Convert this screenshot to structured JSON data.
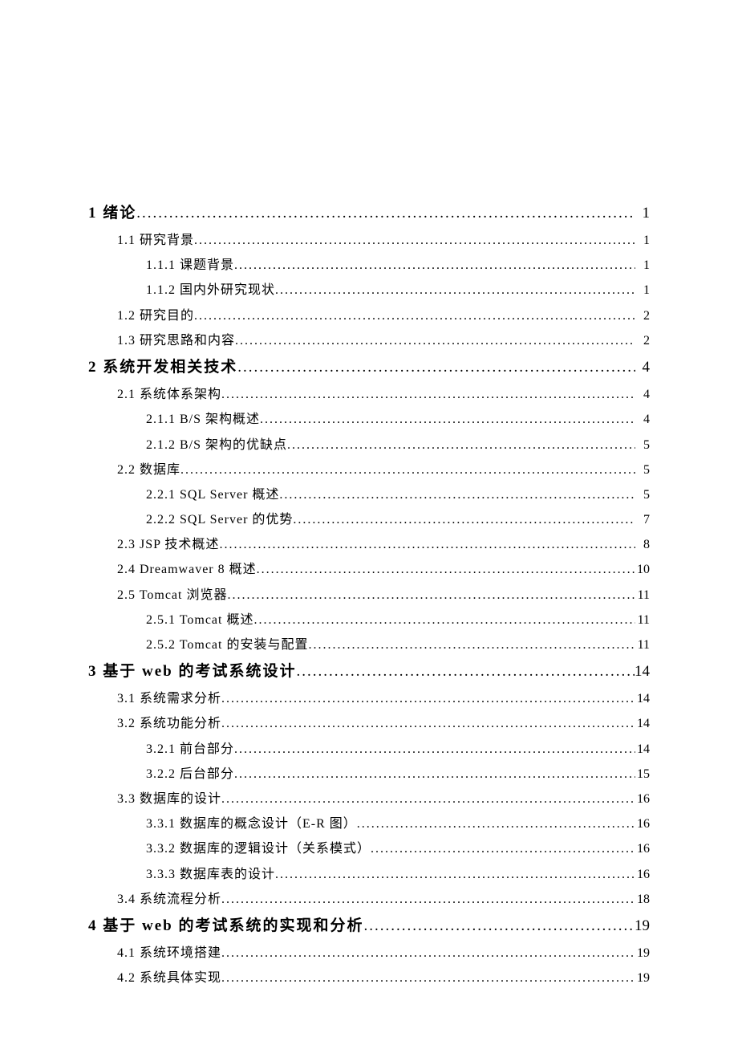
{
  "toc": [
    {
      "level": 0,
      "label": "1 绪论",
      "page": "1"
    },
    {
      "level": 1,
      "label": "1.1 研究背景",
      "page": "1"
    },
    {
      "level": 2,
      "label": "1.1.1 课题背景",
      "page": "1"
    },
    {
      "level": 2,
      "label": "1.1.2 国内外研究现状",
      "page": "1"
    },
    {
      "level": 1,
      "label": "1.2 研究目的",
      "page": "2"
    },
    {
      "level": 1,
      "label": "1.3 研究思路和内容",
      "page": "2"
    },
    {
      "level": 0,
      "label": "2 系统开发相关技术",
      "page": "4"
    },
    {
      "level": 1,
      "label": "2.1 系统体系架构",
      "page": "4"
    },
    {
      "level": 2,
      "label": "2.1.1 B/S 架构概述",
      "page": "4"
    },
    {
      "level": 2,
      "label": "2.1.2 B/S 架构的优缺点",
      "page": "5"
    },
    {
      "level": 1,
      "label": "2.2 数据库",
      "page": "5"
    },
    {
      "level": 2,
      "label": "2.2.1 SQL Server 概述",
      "page": "5"
    },
    {
      "level": 2,
      "label": "2.2.2 SQL Server 的优势",
      "page": "7"
    },
    {
      "level": 1,
      "label": "2.3 JSP 技术概述",
      "page": "8"
    },
    {
      "level": 1,
      "label": "2.4 Dreamwaver 8 概述",
      "page": "10"
    },
    {
      "level": 1,
      "label": "2.5 Tomcat 浏览器",
      "page": "11"
    },
    {
      "level": 2,
      "label": "2.5.1 Tomcat 概述",
      "page": "11"
    },
    {
      "level": 2,
      "label": "2.5.2 Tomcat 的安装与配置",
      "page": "11"
    },
    {
      "level": 0,
      "label": "3 基于 web 的考试系统设计",
      "page": "14"
    },
    {
      "level": 1,
      "label": "3.1 系统需求分析",
      "page": "14"
    },
    {
      "level": 1,
      "label": "3.2 系统功能分析",
      "page": "14"
    },
    {
      "level": 2,
      "label": "3.2.1 前台部分",
      "page": "14"
    },
    {
      "level": 2,
      "label": "3.2.2 后台部分",
      "page": "15"
    },
    {
      "level": 1,
      "label": "3.3 数据库的设计",
      "page": "16"
    },
    {
      "level": 2,
      "label": "3.3.1 数据库的概念设计（E-R 图）",
      "page": "16"
    },
    {
      "level": 2,
      "label": "3.3.2 数据库的逻辑设计（关系模式）",
      "page": "16"
    },
    {
      "level": 2,
      "label": "3.3.3 数据库表的设计",
      "page": "16"
    },
    {
      "level": 1,
      "label": "3.4 系统流程分析",
      "page": "18"
    },
    {
      "level": 0,
      "label": "4 基于 web 的考试系统的实现和分析",
      "page": "19"
    },
    {
      "level": 1,
      "label": "4.1 系统环境搭建",
      "page": "19"
    },
    {
      "level": 1,
      "label": "4.2 系统具体实现",
      "page": "19"
    }
  ]
}
